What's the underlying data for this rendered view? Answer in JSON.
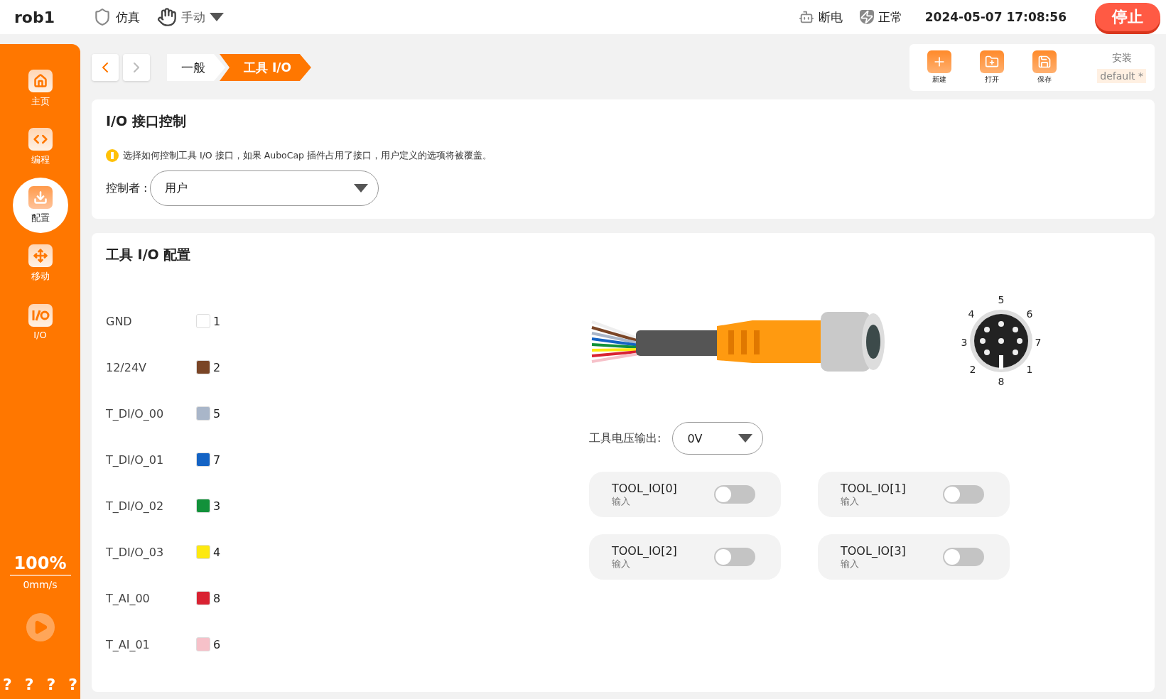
{
  "top_bar": {
    "robot_name": "rob1",
    "mode": "仿真",
    "control": "手动",
    "power": "断电",
    "safety": "正常",
    "datetime": "2024-05-07 17:08:56",
    "stop_button": "停止"
  },
  "sidebar": {
    "items": [
      {
        "label": "主页",
        "kind": "home",
        "selected": false
      },
      {
        "label": "编程",
        "kind": "code",
        "selected": false
      },
      {
        "label": "配置",
        "kind": "config",
        "selected": true
      },
      {
        "label": "移动",
        "kind": "move",
        "selected": false
      },
      {
        "label": "I/O",
        "kind": "io",
        "selected": false
      }
    ],
    "speed": "100%",
    "velocity": "0mm/s",
    "help_marks": [
      "?",
      "?",
      "?",
      "?"
    ]
  },
  "nav": {
    "back_disabled": false,
    "forward_disabled": true
  },
  "breadcrumb": [
    {
      "label": "一般",
      "selected": false
    },
    {
      "label": "工具 I/O",
      "selected": true
    }
  ],
  "toolbar": {
    "buttons": [
      {
        "label": "新建",
        "kind": "new"
      },
      {
        "label": "打开",
        "kind": "open"
      },
      {
        "label": "保存",
        "kind": "save"
      }
    ],
    "install_label": "安装",
    "install_value": "default *"
  },
  "io_control": {
    "title": "I/O 接口控制",
    "info": "选择如何控制工具 I/O 接口，如果 AuboCap 插件占用了接口，用户定义的选项将被覆盖。",
    "controller_label": "控制者 :",
    "controller_value": "用户"
  },
  "tool_io": {
    "title": "工具 I/O 配置",
    "wires": [
      {
        "name": "GND",
        "color": "#ffffff",
        "pin": "1"
      },
      {
        "name": "12/24V",
        "color": "#7a4526",
        "pin": "2"
      },
      {
        "name": "T_DI/O_00",
        "color": "#a9b6c9",
        "pin": "5"
      },
      {
        "name": "T_DI/O_01",
        "color": "#1463c4",
        "pin": "7"
      },
      {
        "name": "T_DI/O_02",
        "color": "#12913a",
        "pin": "3"
      },
      {
        "name": "T_DI/O_03",
        "color": "#fde910",
        "pin": "4"
      },
      {
        "name": "T_AI_00",
        "color": "#d92232",
        "pin": "8"
      },
      {
        "name": "T_AI_01",
        "color": "#f6c1c9",
        "pin": "6"
      }
    ],
    "connector_pins": [
      "5",
      "6",
      "7",
      "1",
      "8",
      "2",
      "3",
      "4"
    ],
    "voltage_label": "工具电压输出:",
    "voltage_value": "0V",
    "switches": [
      {
        "name": "TOOL_IO[0]",
        "mode": "输入",
        "on": false
      },
      {
        "name": "TOOL_IO[1]",
        "mode": "输入",
        "on": false
      },
      {
        "name": "TOOL_IO[2]",
        "mode": "输入",
        "on": false
      },
      {
        "name": "TOOL_IO[3]",
        "mode": "输入",
        "on": false
      }
    ]
  }
}
